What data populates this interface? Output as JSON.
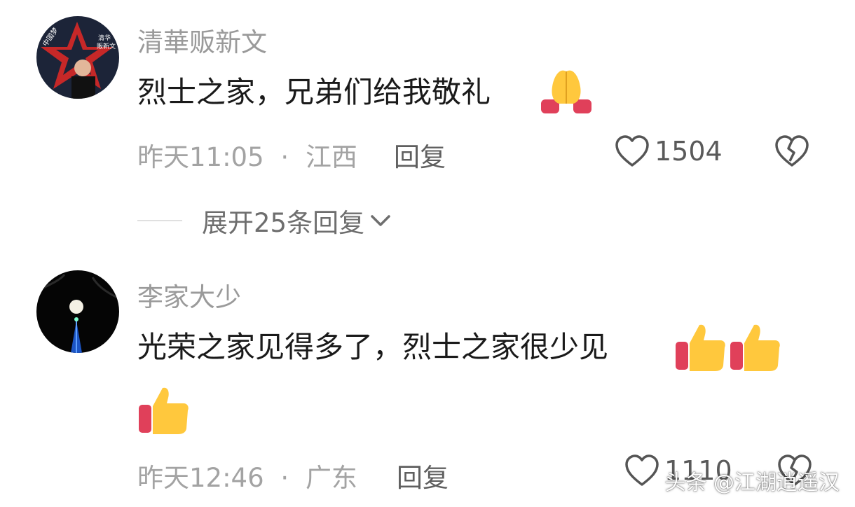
{
  "comments": [
    {
      "username": "清華贩新文",
      "avatar_text": "清华\n贩新文",
      "avatar_slogan": "中国梦",
      "content": "烈士之家，兄弟们给我敬礼",
      "emojis": [
        "folded-hands"
      ],
      "time": "昨天11:05",
      "separator": "·",
      "location": "江西",
      "reply_label": "回复",
      "like_count": "1504",
      "expand_replies_label": "展开25条回复"
    },
    {
      "username": "李家大少",
      "content": "光荣之家见得多了，烈士之家很少见",
      "emojis": [
        "thumbs-up",
        "thumbs-up",
        "thumbs-up"
      ],
      "time": "昨天12:46",
      "separator": "·",
      "location": "广东",
      "reply_label": "回复",
      "like_count": "1110"
    }
  ],
  "watermark": "头条 @江湖逍遥汉",
  "colors": {
    "username": "#9a9a9a",
    "meta": "#a3a3a3",
    "reply": "#5f5f5f",
    "content": "#1a1a1a"
  }
}
